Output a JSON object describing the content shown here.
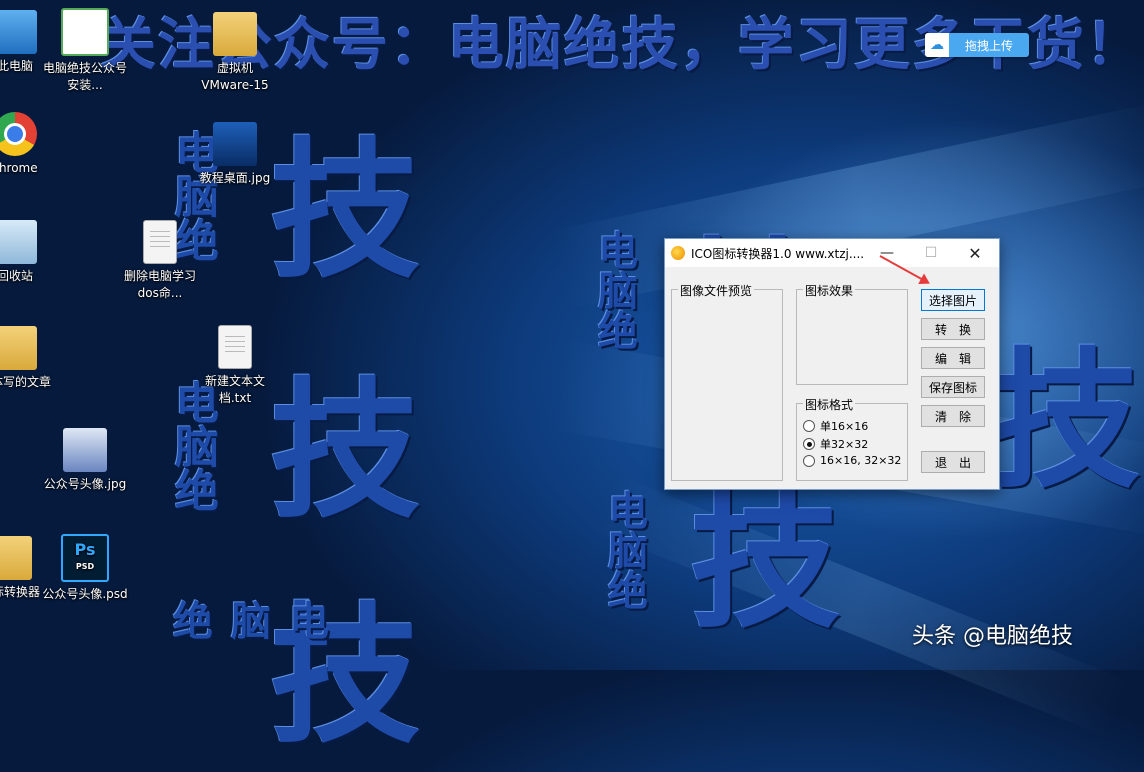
{
  "banner": {
    "text": "关注公众号：电脑绝技，学习更多干货！"
  },
  "watermark": {
    "char_ji": "技",
    "small_text": "电脑绝"
  },
  "upload": {
    "label": "拖拽上传",
    "icon": "cloud-icon"
  },
  "desktop_icons": [
    {
      "label": "此电脑",
      "icon": "pc-icon"
    },
    {
      "label": "电脑绝技公众号安装...",
      "icon": "qr-icon"
    },
    {
      "label": "虚拟机 VMware-15",
      "icon": "folder-icon"
    },
    {
      "label": "chrome",
      "icon": "chrome-icon"
    },
    {
      "label": "教程桌面.jpg",
      "icon": "image-icon"
    },
    {
      "label": "回收站",
      "icon": "recycle-bin-icon"
    },
    {
      "label": "删除电脑学习dos命...",
      "icon": "document-icon"
    },
    {
      "label": "媒体写的文章",
      "icon": "folder-icon"
    },
    {
      "label": "新建文本文档.txt",
      "icon": "document-icon"
    },
    {
      "label": "公众号头像.jpg",
      "icon": "image-icon"
    },
    {
      "label": "图标转换器",
      "icon": "folder-icon"
    },
    {
      "label": "公众号头像.psd",
      "icon": "psd-icon"
    }
  ],
  "window": {
    "title": "ICO图标转换器1.0   www.xtzj....",
    "min": "—",
    "max": "☐",
    "close": "✕",
    "groups": {
      "preview": "图像文件预览",
      "effect": "图标效果",
      "format": "图标格式"
    },
    "formats": [
      {
        "label": "单16×16",
        "selected": false
      },
      {
        "label": "单32×32",
        "selected": true
      },
      {
        "label": "16×16, 32×32",
        "selected": false
      }
    ],
    "buttons": {
      "select": "选择图片",
      "convert": "转　换",
      "edit": "编　辑",
      "save": "保存图标",
      "clear": "清　除",
      "exit": "退　出"
    }
  },
  "credit": "头条 @电脑绝技"
}
